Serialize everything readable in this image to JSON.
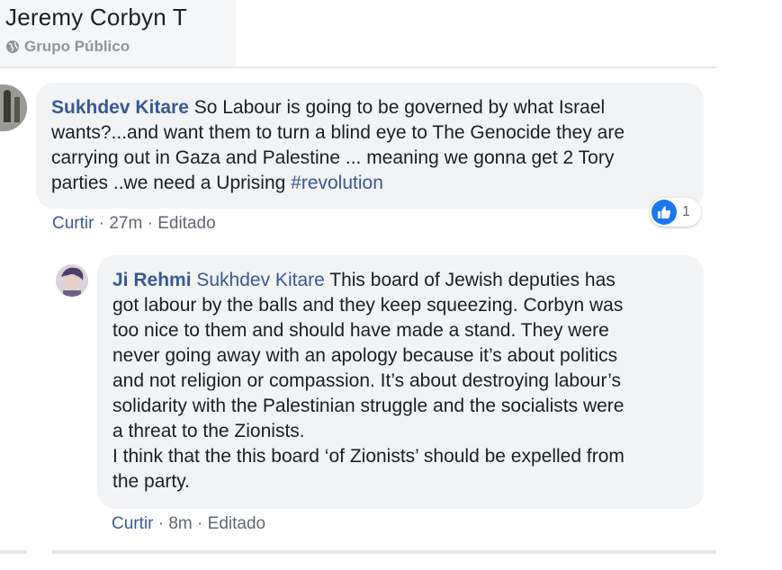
{
  "group": {
    "title": "Jeremy Corbyn T",
    "privacy": "Grupo Público"
  },
  "comments": [
    {
      "author": "Sukhdev Kitare",
      "lines": [
        " So Labour is going to be governed by what Israel",
        "wants?...and want them to turn a blind eye to The Genocide they are",
        "carrying out in Gaza and Palestine ... meaning we gonna get 2 Tory",
        "parties ..we need a Uprising "
      ],
      "hashtag": "#revolution",
      "like_label": "Curtir",
      "time": "27m",
      "edited": "Editado",
      "reaction_count": "1"
    },
    {
      "author": "Ji Rehmi",
      "mention": "Sukhdev Kitare",
      "lines": [
        " This board of Jewish deputies has",
        "got labour by the balls and they keep squeezing. Corbyn was",
        "too nice to them and should have made a stand. They were",
        "never going away with an apology because it’s about politics",
        "and not religion or compassion. It’s about destroying labour’s",
        "solidarity with the Palestinian struggle and the socialists were",
        "a threat to the Zionists.",
        "I think that the this board ‘of Zionists’ should be expelled from",
        "the party."
      ],
      "like_label": "Curtir",
      "time": "8m",
      "edited": "Editado"
    }
  ],
  "icons": {
    "privacy": "globe-icon",
    "reaction": "like-thumb-icon"
  },
  "colors": {
    "link": "#385898",
    "bubble": "#f2f3f5",
    "like_blue": "#1877f2",
    "meta": "#606770"
  }
}
